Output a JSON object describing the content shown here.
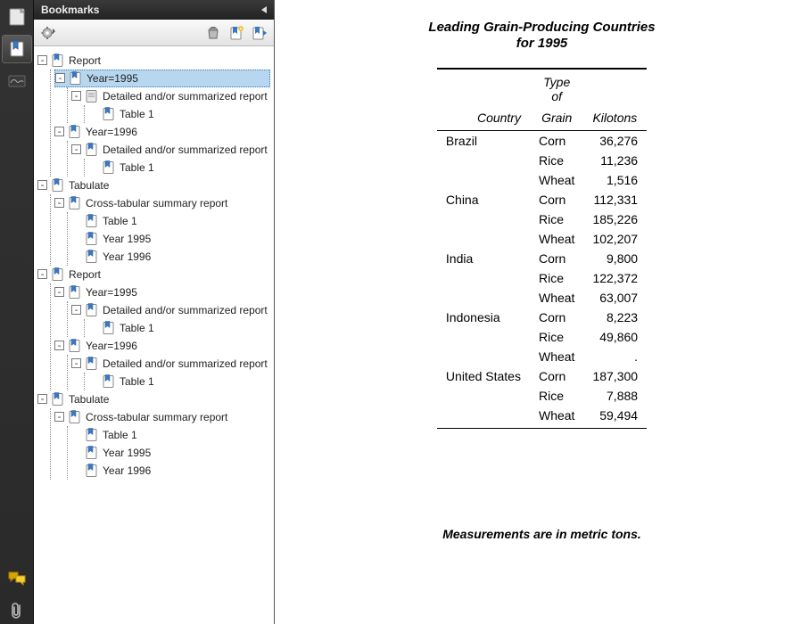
{
  "panel": {
    "title": "Bookmarks"
  },
  "tree": [
    {
      "id": "n0",
      "label": "Report",
      "depth": 0,
      "exp": "-",
      "icon": "page",
      "sel": false
    },
    {
      "id": "n1",
      "label": "Year=1995",
      "depth": 1,
      "exp": "-",
      "icon": "page",
      "sel": true
    },
    {
      "id": "n2",
      "label": "Detailed and/or summarized report",
      "depth": 2,
      "exp": "-",
      "icon": "page-gray",
      "sel": false
    },
    {
      "id": "n3",
      "label": "Table 1",
      "depth": 3,
      "exp": "",
      "icon": "page",
      "sel": false
    },
    {
      "id": "n4",
      "label": "Year=1996",
      "depth": 1,
      "exp": "-",
      "icon": "page",
      "sel": false
    },
    {
      "id": "n5",
      "label": "Detailed and/or summarized report",
      "depth": 2,
      "exp": "-",
      "icon": "page",
      "sel": false
    },
    {
      "id": "n6",
      "label": "Table 1",
      "depth": 3,
      "exp": "",
      "icon": "page",
      "sel": false
    },
    {
      "id": "n7",
      "label": "Tabulate",
      "depth": 0,
      "exp": "-",
      "icon": "page",
      "sel": false
    },
    {
      "id": "n8",
      "label": "Cross-tabular summary report",
      "depth": 1,
      "exp": "-",
      "icon": "page",
      "sel": false
    },
    {
      "id": "n9",
      "label": "Table 1",
      "depth": 2,
      "exp": "",
      "icon": "page",
      "sel": false
    },
    {
      "id": "n10",
      "label": "Year 1995",
      "depth": 2,
      "exp": "",
      "icon": "page",
      "sel": false
    },
    {
      "id": "n11",
      "label": "Year 1996",
      "depth": 2,
      "exp": "",
      "icon": "page",
      "sel": false
    },
    {
      "id": "n12",
      "label": "Report",
      "depth": 0,
      "exp": "-",
      "icon": "page",
      "sel": false
    },
    {
      "id": "n13",
      "label": "Year=1995",
      "depth": 1,
      "exp": "-",
      "icon": "page",
      "sel": false
    },
    {
      "id": "n14",
      "label": "Detailed and/or summarized report",
      "depth": 2,
      "exp": "-",
      "icon": "page",
      "sel": false
    },
    {
      "id": "n15",
      "label": "Table 1",
      "depth": 3,
      "exp": "",
      "icon": "page",
      "sel": false
    },
    {
      "id": "n16",
      "label": "Year=1996",
      "depth": 1,
      "exp": "-",
      "icon": "page",
      "sel": false
    },
    {
      "id": "n17",
      "label": "Detailed and/or summarized report",
      "depth": 2,
      "exp": "-",
      "icon": "page",
      "sel": false
    },
    {
      "id": "n18",
      "label": "Table 1",
      "depth": 3,
      "exp": "",
      "icon": "page",
      "sel": false
    },
    {
      "id": "n19",
      "label": "Tabulate",
      "depth": 0,
      "exp": "-",
      "icon": "page",
      "sel": false
    },
    {
      "id": "n20",
      "label": "Cross-tabular summary report",
      "depth": 1,
      "exp": "-",
      "icon": "page",
      "sel": false
    },
    {
      "id": "n21",
      "label": "Table 1",
      "depth": 2,
      "exp": "",
      "icon": "page",
      "sel": false
    },
    {
      "id": "n22",
      "label": "Year 1995",
      "depth": 2,
      "exp": "",
      "icon": "page",
      "sel": false
    },
    {
      "id": "n23",
      "label": "Year 1996",
      "depth": 2,
      "exp": "",
      "icon": "page",
      "sel": false
    }
  ],
  "doc": {
    "title_line1": "Leading Grain-Producing Countries",
    "title_line2": "for 1995",
    "headers": {
      "country": "Country",
      "type_l1": "Type",
      "type_l2": "of",
      "type_l3": "Grain",
      "kilotons": "Kilotons"
    },
    "rows": [
      {
        "country": "Brazil",
        "grain": "Corn",
        "kilotons": "36,276"
      },
      {
        "country": "",
        "grain": "Rice",
        "kilotons": "11,236"
      },
      {
        "country": "",
        "grain": "Wheat",
        "kilotons": "1,516"
      },
      {
        "country": "China",
        "grain": "Corn",
        "kilotons": "112,331"
      },
      {
        "country": "",
        "grain": "Rice",
        "kilotons": "185,226"
      },
      {
        "country": "",
        "grain": "Wheat",
        "kilotons": "102,207"
      },
      {
        "country": "India",
        "grain": "Corn",
        "kilotons": "9,800"
      },
      {
        "country": "",
        "grain": "Rice",
        "kilotons": "122,372"
      },
      {
        "country": "",
        "grain": "Wheat",
        "kilotons": "63,007"
      },
      {
        "country": "Indonesia",
        "grain": "Corn",
        "kilotons": "8,223"
      },
      {
        "country": "",
        "grain": "Rice",
        "kilotons": "49,860"
      },
      {
        "country": "",
        "grain": "Wheat",
        "kilotons": "."
      },
      {
        "country": "United States",
        "grain": "Corn",
        "kilotons": "187,300"
      },
      {
        "country": "",
        "grain": "Rice",
        "kilotons": "7,888"
      },
      {
        "country": "",
        "grain": "Wheat",
        "kilotons": "59,494"
      }
    ],
    "footnote": "Measurements are in metric tons."
  },
  "chart_data": {
    "type": "table",
    "title": "Leading Grain-Producing Countries for 1995",
    "columns": [
      "Country",
      "Type of Grain",
      "Kilotons"
    ],
    "rows": [
      [
        "Brazil",
        "Corn",
        36276
      ],
      [
        "Brazil",
        "Rice",
        11236
      ],
      [
        "Brazil",
        "Wheat",
        1516
      ],
      [
        "China",
        "Corn",
        112331
      ],
      [
        "China",
        "Rice",
        185226
      ],
      [
        "China",
        "Wheat",
        102207
      ],
      [
        "India",
        "Corn",
        9800
      ],
      [
        "India",
        "Rice",
        122372
      ],
      [
        "India",
        "Wheat",
        63007
      ],
      [
        "Indonesia",
        "Corn",
        8223
      ],
      [
        "Indonesia",
        "Rice",
        49860
      ],
      [
        "Indonesia",
        "Wheat",
        null
      ],
      [
        "United States",
        "Corn",
        187300
      ],
      [
        "United States",
        "Rice",
        7888
      ],
      [
        "United States",
        "Wheat",
        59494
      ]
    ],
    "footnote": "Measurements are in metric tons."
  }
}
